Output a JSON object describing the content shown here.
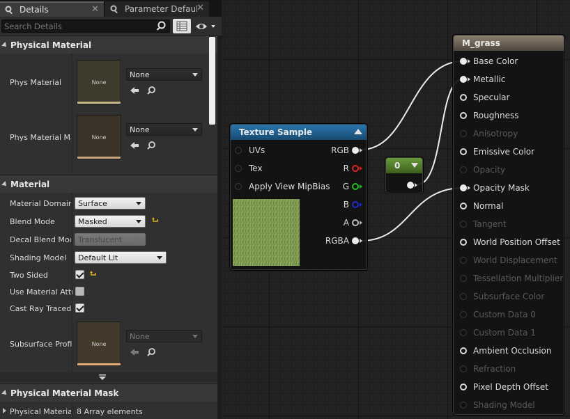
{
  "tabs": [
    {
      "label": "Details",
      "icon": "search-doc-icon",
      "close": "✕"
    },
    {
      "label": "Parameter Defaults",
      "icon": "search-doc-icon",
      "close": "✕"
    }
  ],
  "search": {
    "placeholder": "Search Details"
  },
  "sections": {
    "physical_material": "Physical Material",
    "material": "Material",
    "physical_material_mask": "Physical Material Mask"
  },
  "physical_material_rows": [
    {
      "label": "Phys Material",
      "thumb_text": "None",
      "value": "None"
    },
    {
      "label": "Phys Material Ma",
      "thumb_text": "None",
      "value": "None"
    }
  ],
  "material_rows": [
    {
      "label": "Material Domain",
      "value": "Surface"
    },
    {
      "label": "Blend Mode",
      "value": "Masked"
    },
    {
      "label": "Decal Blend Mode",
      "value": "Translucent"
    },
    {
      "label": "Shading Model",
      "value": "Default Lit"
    },
    {
      "label": "Two Sided",
      "checked": true
    },
    {
      "label": "Use Material Attri",
      "checked": false
    },
    {
      "label": "Cast Ray Traced S",
      "checked": true
    },
    {
      "label": "Subsurface Profil",
      "thumb_text": "None",
      "value": "None"
    }
  ],
  "mask_rows": [
    {
      "label": "Physical Material",
      "value": "8 Array elements"
    }
  ],
  "nodes": {
    "texture_sample": {
      "title": "Texture Sample",
      "inputs": [
        "UVs",
        "Tex",
        "Apply View MipBias"
      ],
      "outputs": [
        {
          "label": "RGB",
          "color": "#e8e8e8"
        },
        {
          "label": "R",
          "color": "#e02020"
        },
        {
          "label": "G",
          "color": "#20c020"
        },
        {
          "label": "B",
          "color": "#1e2ad0"
        },
        {
          "label": "A",
          "color": "#bcbcbc"
        },
        {
          "label": "RGBA",
          "color": "#e8e8e8"
        }
      ]
    },
    "constant": {
      "value": "0"
    },
    "material": {
      "title": "M_grass",
      "pins": [
        {
          "label": "Base Color",
          "state": "connected"
        },
        {
          "label": "Metallic",
          "state": "connected"
        },
        {
          "label": "Specular",
          "state": "active"
        },
        {
          "label": "Roughness",
          "state": "active"
        },
        {
          "label": "Anisotropy",
          "state": "disabled"
        },
        {
          "label": "Emissive Color",
          "state": "active"
        },
        {
          "label": "Opacity",
          "state": "disabled"
        },
        {
          "label": "Opacity Mask",
          "state": "connected"
        },
        {
          "label": "Normal",
          "state": "active"
        },
        {
          "label": "Tangent",
          "state": "disabled"
        },
        {
          "label": "World Position Offset",
          "state": "active"
        },
        {
          "label": "World Displacement",
          "state": "disabled"
        },
        {
          "label": "Tessellation Multiplier",
          "state": "disabled"
        },
        {
          "label": "Subsurface Color",
          "state": "disabled"
        },
        {
          "label": "Custom Data 0",
          "state": "disabled"
        },
        {
          "label": "Custom Data 1",
          "state": "disabled"
        },
        {
          "label": "Ambient Occlusion",
          "state": "active"
        },
        {
          "label": "Refraction",
          "state": "disabled"
        },
        {
          "label": "Pixel Depth Offset",
          "state": "active"
        },
        {
          "label": "Shading Model",
          "state": "disabled"
        }
      ]
    }
  },
  "colors": {
    "texture_header": "#1d5b86",
    "constant_header": "#4f7a2a",
    "material_header": "#6b6157",
    "reset_arrow": "#e2b21b"
  }
}
